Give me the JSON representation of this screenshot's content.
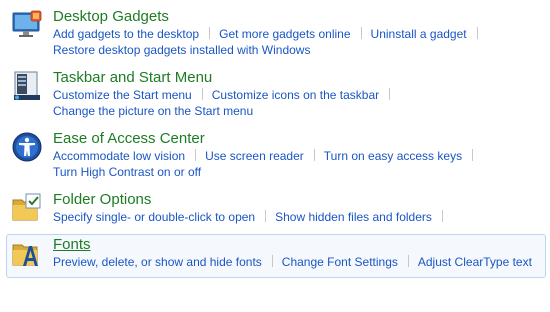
{
  "categories": [
    {
      "title": "Desktop Gadgets",
      "icon": "desktop-gadgets-icon",
      "line1": [
        "Add gadgets to the desktop",
        "Get more gadgets online",
        "Uninstall a gadget"
      ],
      "line2": [
        "Restore desktop gadgets installed with Windows"
      ]
    },
    {
      "title": "Taskbar and Start Menu",
      "icon": "taskbar-icon",
      "line1": [
        "Customize the Start menu",
        "Customize icons on the taskbar"
      ],
      "line2": [
        "Change the picture on the Start menu"
      ]
    },
    {
      "title": "Ease of Access Center",
      "icon": "ease-of-access-icon",
      "line1": [
        "Accommodate low vision",
        "Use screen reader",
        "Turn on easy access keys"
      ],
      "line2": [
        "Turn High Contrast on or off"
      ]
    },
    {
      "title": "Folder Options",
      "icon": "folder-options-icon",
      "line1": [
        "Specify single- or double-click to open",
        "Show hidden files and folders"
      ]
    },
    {
      "title": "Fonts",
      "icon": "fonts-icon",
      "line1": [
        "Preview, delete, or show and hide fonts",
        "Change Font Settings",
        "Adjust ClearType text"
      ]
    }
  ],
  "colors": {
    "title_green": "#1e7d24",
    "link_blue": "#1a56c4",
    "hover_bg": "#f5f9fd",
    "hover_border": "#b8d6f0"
  }
}
